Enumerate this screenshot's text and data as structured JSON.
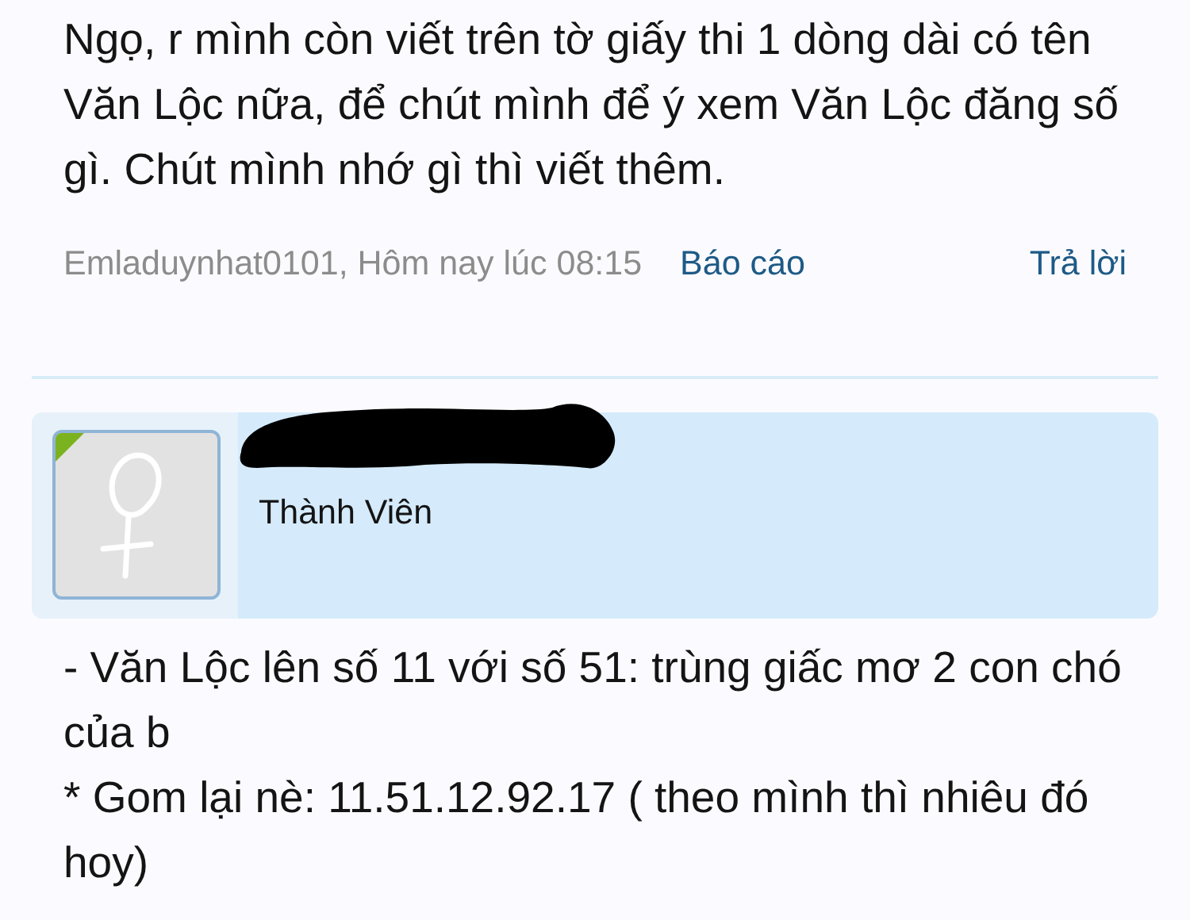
{
  "post_top": {
    "text": "Ngọ, r mình còn viết trên tờ giấy thi 1 dòng dài có tên Văn Lộc nữa, để chút mình để ý xem Văn Lộc đăng số gì. Chút mình nhớ gì thì viết thêm.",
    "meta": "Emladuynhat0101, Hôm nay lúc 08:15",
    "report": "Báo cáo",
    "reply": "Trả lời"
  },
  "user": {
    "online": true,
    "role": "Thành Viên"
  },
  "post_body": [
    "- Văn Lộc lên số 11 với số 51: trùng giấc mơ 2 con chó của b",
    "* Gom lại nè: 11.51.12.92.17 ( theo mình thì nhiêu đó hoy)"
  ]
}
